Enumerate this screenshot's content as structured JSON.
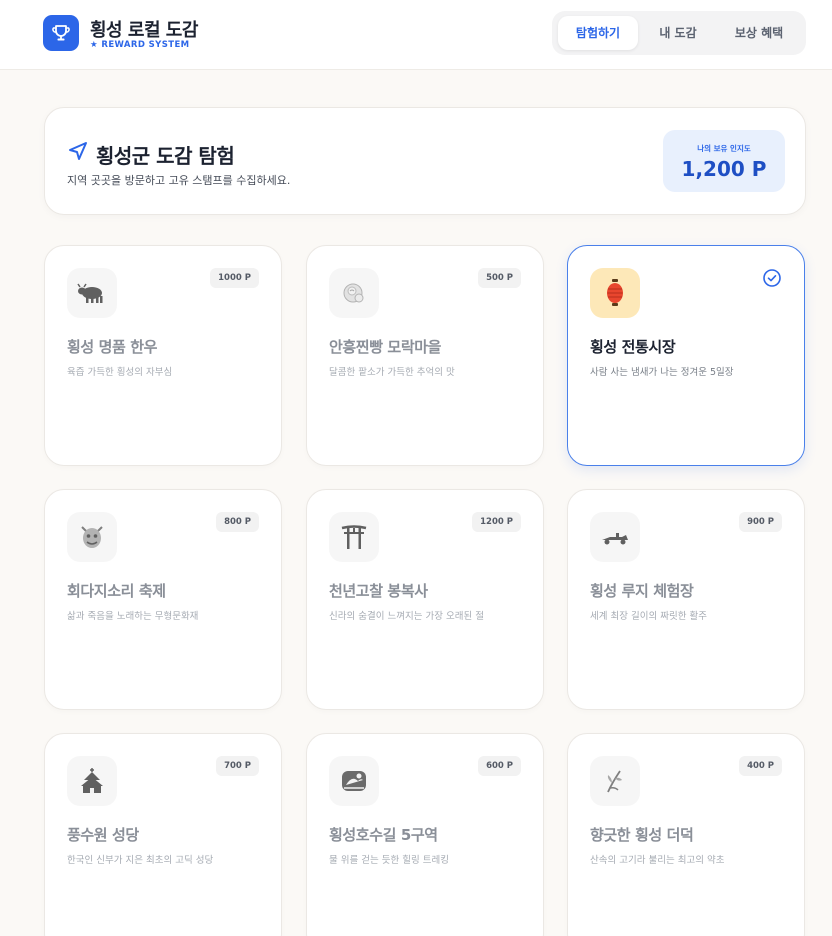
{
  "header": {
    "title": "횡성 로컬 도감",
    "subtitle": "★ REWARD SYSTEM",
    "logo_icon": "trophy-icon",
    "nav": [
      {
        "label": "탐험하기",
        "active": true
      },
      {
        "label": "내 도감",
        "active": false
      },
      {
        "label": "보상 혜택",
        "active": false
      }
    ]
  },
  "hero": {
    "icon": "navigation-arrow-icon",
    "title": "횡성군 도감 탐험",
    "subtitle": "지역 곳곳을 방문하고 고유 스탬프를 수집하세요.",
    "points_label": "나의 보유 인지도",
    "points_value": "1,200 P"
  },
  "colors": {
    "accent": "#2c66e8",
    "accent_dark": "#1e4fc4",
    "points_bg": "#e8f0fd",
    "visited_icon_bg": "#fde8b8"
  },
  "cards": [
    {
      "title": "횡성 명품 한우",
      "desc": "육즙 가득한 횡성의 자부심",
      "points": "1000 P",
      "icon": "ox-icon",
      "visited": false
    },
    {
      "title": "안흥찐빵 모락마을",
      "desc": "달콤한 팥소가 가득한 추억의 맛",
      "points": "500 P",
      "icon": "steamed-bun-icon",
      "visited": false
    },
    {
      "title": "횡성 전통시장",
      "desc": "사람 사는 냄새가 나는 정겨운 5일장",
      "points": "",
      "icon": "lantern-icon",
      "visited": true
    },
    {
      "title": "회다지소리 축제",
      "desc": "삶과 죽음을 노래하는 무형문화재",
      "points": "800 P",
      "icon": "mask-icon",
      "visited": false
    },
    {
      "title": "천년고찰 봉복사",
      "desc": "신라의 숨결이 느껴지는 가장 오래된 절",
      "points": "1200 P",
      "icon": "gate-icon",
      "visited": false
    },
    {
      "title": "횡성 루지 체험장",
      "desc": "세계 최장 길이의 짜릿한 활주",
      "points": "900 P",
      "icon": "luge-cart-icon",
      "visited": false
    },
    {
      "title": "풍수원 성당",
      "desc": "한국인 신부가 지은 최초의 고딕 성당",
      "points": "700 P",
      "icon": "church-icon",
      "visited": false
    },
    {
      "title": "횡성호수길 5구역",
      "desc": "물 위를 걷는 듯한 힐링 트레킹",
      "points": "600 P",
      "icon": "lake-icon",
      "visited": false
    },
    {
      "title": "향긋한 횡성 더덕",
      "desc": "산속의 고기라 불리는 최고의 약초",
      "points": "400 P",
      "icon": "herb-icon",
      "visited": false
    }
  ]
}
